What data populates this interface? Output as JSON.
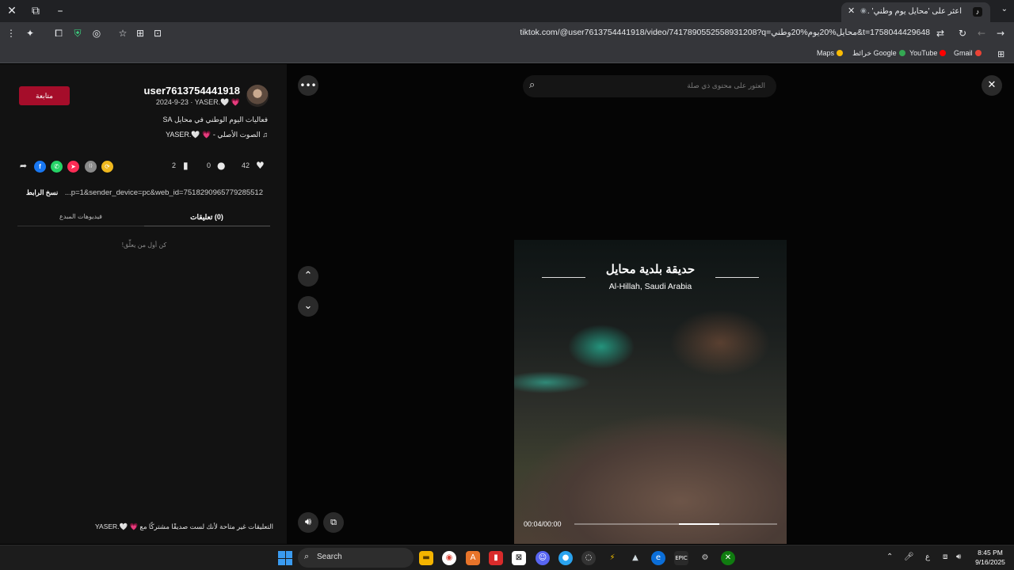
{
  "browser": {
    "tab_title": "اعثر على 'محايل يوم وطني' ...",
    "url": "tiktok.com/@user7613754441918/video/7417890552558931208?q=محايل%20يوم%20وطني&t=1758044429648",
    "bookmarks": [
      {
        "label": "Gmail",
        "color": "#ea4335"
      },
      {
        "label": "YouTube",
        "color": "#ff0000"
      },
      {
        "label": "خرائط Google",
        "color": "#34a853"
      },
      {
        "label": "Maps",
        "color": "#fbbc04"
      }
    ]
  },
  "profile": {
    "username": "user7613754441918",
    "meta": "2024-9-23 · YASER.🤍 💗",
    "follow_label": "متابعة",
    "caption": "فعاليات اليوم الوطني في محايل SA",
    "music": "♫ الصوت الأصلي - 💗 🤍.YASER"
  },
  "stats": {
    "likes": "42",
    "comments": "0",
    "saves": "2"
  },
  "share_icons": [
    {
      "name": "share-arrow-icon",
      "glyph": "➦",
      "color": "transparent"
    },
    {
      "name": "facebook-icon",
      "glyph": "f",
      "color": "#1877f2"
    },
    {
      "name": "whatsapp-icon",
      "glyph": "✆",
      "color": "#25d366"
    },
    {
      "name": "telegram-icon",
      "glyph": "➤",
      "color": "#fe2c55"
    },
    {
      "name": "embed-icon",
      "glyph": "⟨⟩",
      "color": "#8a8a8a"
    },
    {
      "name": "repost-icon",
      "glyph": "⟳",
      "color": "#f0b81e"
    }
  ],
  "link": {
    "copy_label": "نسخ الرابط",
    "text": "...p=1&sender_device=pc&web_id=7518290965779285512"
  },
  "tabs": {
    "comments": "(0) تعليقات",
    "creator_videos": "فيديوهات المبدع"
  },
  "comments": {
    "empty_text": "كن أول من يعلِّق!",
    "disabled_text": "التعليقات غير متاحة لأنك لست صديقًا مشتركًا مع 💗 🤍.YASER"
  },
  "search": {
    "placeholder": "العثور على محتوى ذي صلة"
  },
  "video": {
    "title": "حديقة بلدية محايل",
    "subtitle": "Al-Hillah, Saudi Arabia",
    "time": "00:04/00:00",
    "progress": 0.2
  },
  "taskbar": {
    "search_label": "Search",
    "lang": "ع",
    "time": "8:45 PM",
    "date": "9/16/2025"
  }
}
